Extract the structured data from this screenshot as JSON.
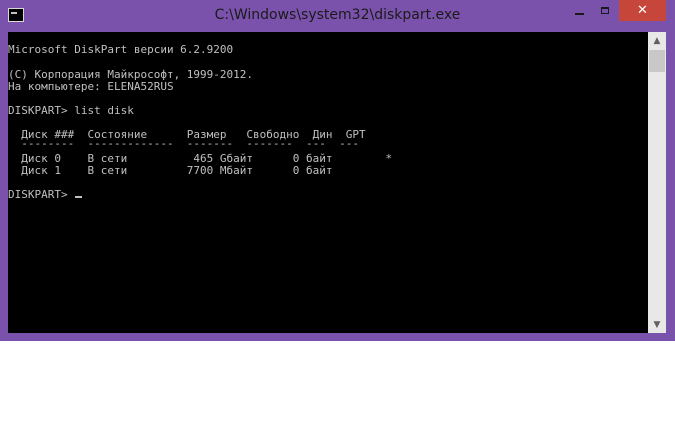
{
  "window": {
    "title": "C:\\Windows\\system32\\diskpart.exe"
  },
  "controls": {
    "minimize_icon": "minimize-icon",
    "maximize_icon": "maximize-icon",
    "close_icon": "close-icon",
    "close_glyph": "✕"
  },
  "colors": {
    "frame": "#7b52ab",
    "console_bg": "#000000",
    "console_text": "#c0c0c0",
    "close_button": "#c7463b"
  },
  "console": {
    "lines": [
      "Microsoft DiskPart версии 6.2.9200",
      "(C) Корпорация Майкрософт, 1999-2012.",
      "На компьютере: ELENA52RUS",
      "DISKPART> list disk",
      "  Диск ###  Состояние      Размер   Свободно  Дин  GPT",
      "  --------  -------------  -------  -------  ---  ---",
      "  Диск 0    В сети          465 Gбайт      0 байт        *",
      "  Диск 1    В сети         7700 Мбайт      0 байт",
      "DISKPART> "
    ]
  },
  "scrollbar": {
    "up_glyph": "▲",
    "down_glyph": "▼"
  }
}
